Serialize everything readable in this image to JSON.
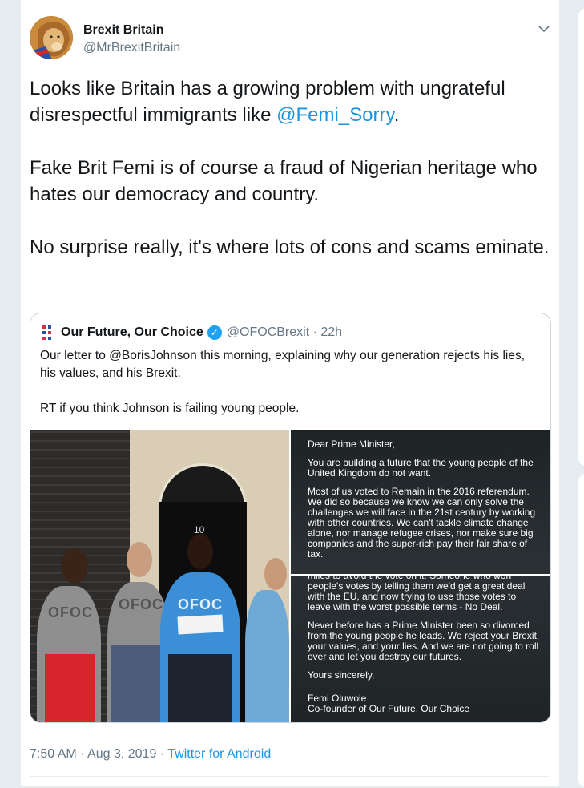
{
  "tweet": {
    "author_name": "Brexit Britain",
    "author_handle": "@MrBrexitBritain",
    "para1_text": "Looks like Britain has a growing problem with ungrateful disrespectful immigrants like ",
    "para1_mention": "@Femi_Sorry",
    "para1_end": ".",
    "para2": "Fake Brit Femi is of course a fraud of Nigerian heritage who hates our democracy and country.",
    "para3": "No surprise really, it's where lots of cons and scams eminate.",
    "timestamp": "7:50 AM · Aug 3, 2019 · ",
    "source": "Twitter for Android"
  },
  "quote": {
    "name": "Our Future, Our Choice",
    "handle": "@OFOCBrexit · 22h",
    "para1": "Our letter to @BorisJohnson this morning, explaining why our generation rejects his lies, his values, and his Brexit.",
    "para2": "RT if you think Johnson is failing young people."
  },
  "photo": {
    "door_number": "10",
    "shirt_text": "OFOC"
  },
  "letter_top": {
    "greeting": "Dear Prime Minister,",
    "p1": "You are building a future that the young people of the United Kingdom do not want.",
    "p2": "Most of us voted to Remain in the 2016 referendum. We did so because we know we can only solve the challenges we will face in the 21st century by working with other countries. We can't tackle climate change alone, nor manage refugee crises, nor make sure big companies and the super-rich pay their fair share of tax."
  },
  "letter_bottom": {
    "p0": "miles to avoid the vote on it. Someone who won people's votes by telling them we'd get a great deal with the EU, and now trying to use those votes to leave with the worst possible terms - No Deal.",
    "p1": "Never before has a Prime Minister been so divorced from the young people he leads. We reject your Brexit, your values, and your lies. And we are not going to roll over and let you destroy our futures.",
    "closing": "Yours sincerely,",
    "signature": "Femi Oluwole",
    "title": "Co-founder of Our Future, Our Choice"
  },
  "colors": {
    "link": "#1b95e0",
    "verified": "#1da1f2",
    "text": "#14171a",
    "muted": "#657786"
  },
  "icons": [
    "avatar-lion",
    "chevron-down-icon",
    "ofoc-logo-icon",
    "verified-badge-icon"
  ]
}
